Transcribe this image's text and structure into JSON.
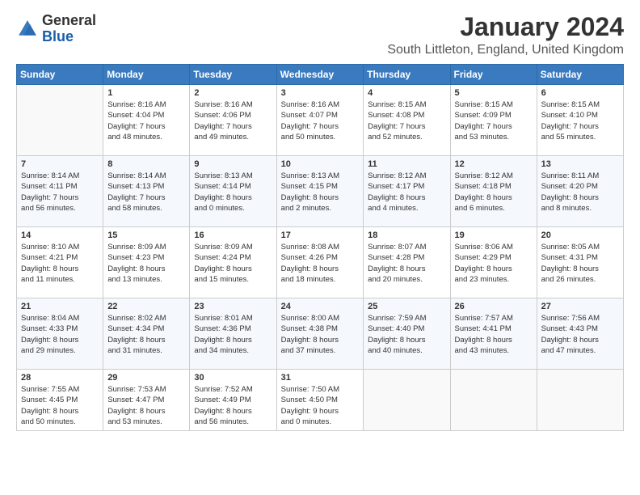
{
  "header": {
    "logo": {
      "general": "General",
      "blue": "Blue"
    },
    "title": "January 2024",
    "location": "South Littleton, England, United Kingdom"
  },
  "calendar": {
    "days_of_week": [
      "Sunday",
      "Monday",
      "Tuesday",
      "Wednesday",
      "Thursday",
      "Friday",
      "Saturday"
    ],
    "weeks": [
      [
        {
          "day": "",
          "info": ""
        },
        {
          "day": "1",
          "info": "Sunrise: 8:16 AM\nSunset: 4:04 PM\nDaylight: 7 hours\nand 48 minutes."
        },
        {
          "day": "2",
          "info": "Sunrise: 8:16 AM\nSunset: 4:06 PM\nDaylight: 7 hours\nand 49 minutes."
        },
        {
          "day": "3",
          "info": "Sunrise: 8:16 AM\nSunset: 4:07 PM\nDaylight: 7 hours\nand 50 minutes."
        },
        {
          "day": "4",
          "info": "Sunrise: 8:15 AM\nSunset: 4:08 PM\nDaylight: 7 hours\nand 52 minutes."
        },
        {
          "day": "5",
          "info": "Sunrise: 8:15 AM\nSunset: 4:09 PM\nDaylight: 7 hours\nand 53 minutes."
        },
        {
          "day": "6",
          "info": "Sunrise: 8:15 AM\nSunset: 4:10 PM\nDaylight: 7 hours\nand 55 minutes."
        }
      ],
      [
        {
          "day": "7",
          "info": "Sunrise: 8:14 AM\nSunset: 4:11 PM\nDaylight: 7 hours\nand 56 minutes."
        },
        {
          "day": "8",
          "info": "Sunrise: 8:14 AM\nSunset: 4:13 PM\nDaylight: 7 hours\nand 58 minutes."
        },
        {
          "day": "9",
          "info": "Sunrise: 8:13 AM\nSunset: 4:14 PM\nDaylight: 8 hours\nand 0 minutes."
        },
        {
          "day": "10",
          "info": "Sunrise: 8:13 AM\nSunset: 4:15 PM\nDaylight: 8 hours\nand 2 minutes."
        },
        {
          "day": "11",
          "info": "Sunrise: 8:12 AM\nSunset: 4:17 PM\nDaylight: 8 hours\nand 4 minutes."
        },
        {
          "day": "12",
          "info": "Sunrise: 8:12 AM\nSunset: 4:18 PM\nDaylight: 8 hours\nand 6 minutes."
        },
        {
          "day": "13",
          "info": "Sunrise: 8:11 AM\nSunset: 4:20 PM\nDaylight: 8 hours\nand 8 minutes."
        }
      ],
      [
        {
          "day": "14",
          "info": "Sunrise: 8:10 AM\nSunset: 4:21 PM\nDaylight: 8 hours\nand 11 minutes."
        },
        {
          "day": "15",
          "info": "Sunrise: 8:09 AM\nSunset: 4:23 PM\nDaylight: 8 hours\nand 13 minutes."
        },
        {
          "day": "16",
          "info": "Sunrise: 8:09 AM\nSunset: 4:24 PM\nDaylight: 8 hours\nand 15 minutes."
        },
        {
          "day": "17",
          "info": "Sunrise: 8:08 AM\nSunset: 4:26 PM\nDaylight: 8 hours\nand 18 minutes."
        },
        {
          "day": "18",
          "info": "Sunrise: 8:07 AM\nSunset: 4:28 PM\nDaylight: 8 hours\nand 20 minutes."
        },
        {
          "day": "19",
          "info": "Sunrise: 8:06 AM\nSunset: 4:29 PM\nDaylight: 8 hours\nand 23 minutes."
        },
        {
          "day": "20",
          "info": "Sunrise: 8:05 AM\nSunset: 4:31 PM\nDaylight: 8 hours\nand 26 minutes."
        }
      ],
      [
        {
          "day": "21",
          "info": "Sunrise: 8:04 AM\nSunset: 4:33 PM\nDaylight: 8 hours\nand 29 minutes."
        },
        {
          "day": "22",
          "info": "Sunrise: 8:02 AM\nSunset: 4:34 PM\nDaylight: 8 hours\nand 31 minutes."
        },
        {
          "day": "23",
          "info": "Sunrise: 8:01 AM\nSunset: 4:36 PM\nDaylight: 8 hours\nand 34 minutes."
        },
        {
          "day": "24",
          "info": "Sunrise: 8:00 AM\nSunset: 4:38 PM\nDaylight: 8 hours\nand 37 minutes."
        },
        {
          "day": "25",
          "info": "Sunrise: 7:59 AM\nSunset: 4:40 PM\nDaylight: 8 hours\nand 40 minutes."
        },
        {
          "day": "26",
          "info": "Sunrise: 7:57 AM\nSunset: 4:41 PM\nDaylight: 8 hours\nand 43 minutes."
        },
        {
          "day": "27",
          "info": "Sunrise: 7:56 AM\nSunset: 4:43 PM\nDaylight: 8 hours\nand 47 minutes."
        }
      ],
      [
        {
          "day": "28",
          "info": "Sunrise: 7:55 AM\nSunset: 4:45 PM\nDaylight: 8 hours\nand 50 minutes."
        },
        {
          "day": "29",
          "info": "Sunrise: 7:53 AM\nSunset: 4:47 PM\nDaylight: 8 hours\nand 53 minutes."
        },
        {
          "day": "30",
          "info": "Sunrise: 7:52 AM\nSunset: 4:49 PM\nDaylight: 8 hours\nand 56 minutes."
        },
        {
          "day": "31",
          "info": "Sunrise: 7:50 AM\nSunset: 4:50 PM\nDaylight: 9 hours\nand 0 minutes."
        },
        {
          "day": "",
          "info": ""
        },
        {
          "day": "",
          "info": ""
        },
        {
          "day": "",
          "info": ""
        }
      ]
    ]
  }
}
